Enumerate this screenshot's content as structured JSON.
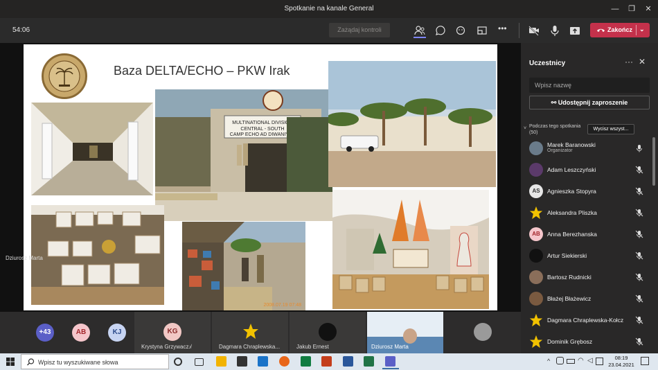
{
  "window": {
    "title": "Spotkanie na kanale General"
  },
  "toolbar": {
    "timer": "54:06",
    "request_control": "Zażądaj kontroli",
    "leave_label": "Zakończ"
  },
  "slide": {
    "title": "Baza DELTA/ECHO – PKW Irak",
    "photo_sign_text": "MULTINATIONAL DIVISION CENTRAL - SOUTH CAMP ECHO AD DIWANIYAH",
    "photo_date_stamp": "2008.07.19 07:48"
  },
  "stage": {
    "presenter_name": "Dziurosz Marta"
  },
  "strip": {
    "overflow_count": "+43",
    "avatars": [
      "AB",
      "KJ"
    ],
    "tiles": [
      {
        "initials": "KG",
        "name": "Krystyna Grzywacz"
      },
      {
        "name": "Dagmara Chraplewska..."
      },
      {
        "name": "Jakub Ernest"
      },
      {
        "name": "Dziurosz Marta"
      }
    ]
  },
  "panel": {
    "title": "Uczestnicy",
    "search_placeholder": "Wpisz nazwę",
    "share_label": "Udostępnij zaproszenie",
    "section_label": "Podczas tego spotkania (50)",
    "mute_all": "Wycisz wszyst...",
    "participants": [
      {
        "name": "Marek Baranowski",
        "role": "Organizator",
        "initials": "",
        "color": "#6a7b8a"
      },
      {
        "name": "Adam Leszczyński",
        "initials": "",
        "color": "#5b3a6a"
      },
      {
        "name": "Agnieszka Stopyra",
        "initials": "AS",
        "color": "#e6e6e6"
      },
      {
        "name": "Aleksandra Pliszka",
        "initials": "",
        "color": "#f2c200"
      },
      {
        "name": "Anna Berezhanska",
        "initials": "AB",
        "color": "#f5c6cb"
      },
      {
        "name": "Artur Siekierski",
        "initials": "",
        "color": "#111111"
      },
      {
        "name": "Bartosz Rudnicki",
        "initials": "",
        "color": "#8a6e5a"
      },
      {
        "name": "Błażej Błażewicz",
        "initials": "",
        "color": "#7a5a40"
      },
      {
        "name": "Dagmara Chraplewska-Kołcz",
        "initials": "",
        "color": "#f2c200"
      },
      {
        "name": "Dominik Grębosz",
        "initials": "",
        "color": "#f2c200"
      }
    ]
  },
  "taskbar": {
    "search_placeholder": "Wpisz tu wyszukiwane słowa",
    "time": "08:19",
    "date": "23.04.2021"
  }
}
